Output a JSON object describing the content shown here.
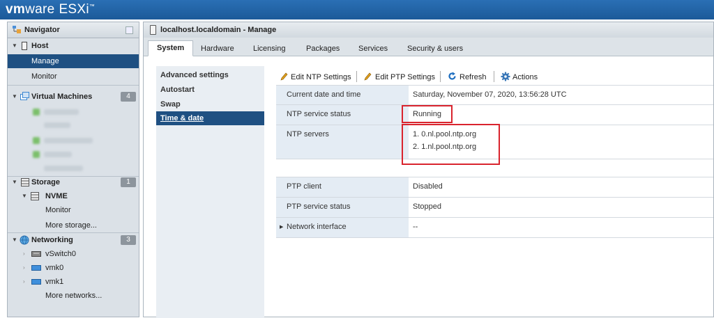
{
  "app": {
    "brand": "vm",
    "brand_rest": "ware",
    "product": "ESXi",
    "trademark": "™"
  },
  "navigator": {
    "title": "Navigator",
    "host": {
      "label": "Host",
      "manage": "Manage",
      "monitor": "Monitor"
    },
    "vms": {
      "label": "Virtual Machines",
      "count": "4"
    },
    "storage": {
      "label": "Storage",
      "count": "1",
      "datastore": "NVME",
      "monitor": "Monitor",
      "more": "More storage..."
    },
    "networking": {
      "label": "Networking",
      "count": "3",
      "items": [
        "vSwitch0",
        "vmk0",
        "vmk1"
      ],
      "more": "More networks..."
    }
  },
  "main": {
    "title": "localhost.localdomain - Manage",
    "tabs": [
      "System",
      "Hardware",
      "Licensing",
      "Packages",
      "Services",
      "Security & users"
    ],
    "subnav": [
      "Advanced settings",
      "Autostart",
      "Swap",
      "Time & date"
    ],
    "toolbar": {
      "edit_ntp": "Edit NTP Settings",
      "edit_ptp": "Edit PTP Settings",
      "refresh": "Refresh",
      "actions": "Actions"
    },
    "ntp_table": {
      "current_date_label": "Current date and time",
      "current_date_value": "Saturday, November 07, 2020, 13:56:28 UTC",
      "ntp_status_label": "NTP service status",
      "ntp_status_value": "Running",
      "ntp_servers_label": "NTP servers",
      "ntp_server_1": "1. 0.nl.pool.ntp.org",
      "ntp_server_2": "2. 1.nl.pool.ntp.org"
    },
    "ptp_table": {
      "client_label": "PTP client",
      "client_value": "Disabled",
      "status_label": "PTP service status",
      "status_value": "Stopped",
      "netif_label": "Network interface",
      "netif_value": "--"
    }
  },
  "colors": {
    "topbar": "#1c5a99",
    "selection": "#1f5082",
    "highlight": "#d9232d",
    "key_cell": "#e4ecf4"
  }
}
